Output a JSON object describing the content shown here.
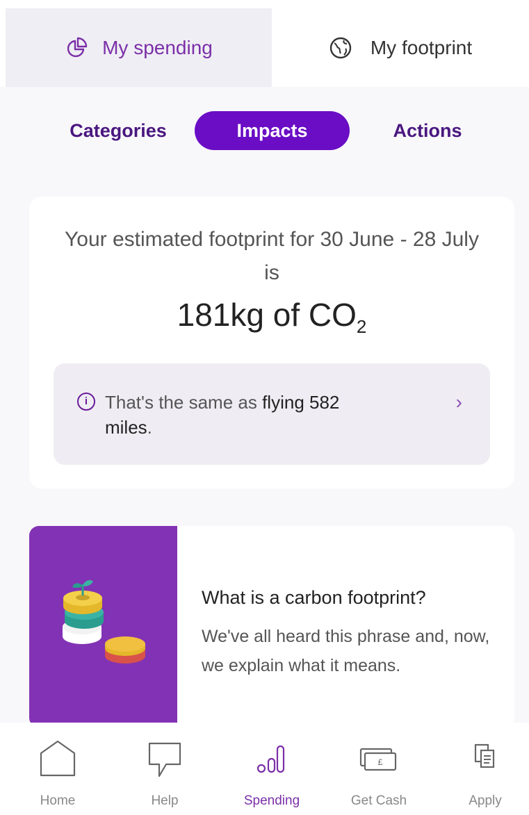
{
  "top_tabs": {
    "spending": {
      "label": "My spending",
      "icon": "pie-chart-icon"
    },
    "footprint": {
      "label": "My footprint",
      "icon": "globe-icon"
    }
  },
  "segments": {
    "categories": "Categories",
    "impacts": "Impacts",
    "actions": "Actions"
  },
  "footprint_card": {
    "estimate_text": "Your estimated footprint for 30 June - 28 July is",
    "co2_prefix": "181kg of CO",
    "co2_sub": "2",
    "info_prefix": "That's the same as ",
    "info_bold": "flying 582",
    "info_suffix": "miles",
    "info_period": ".",
    "info_icon": "info-icon",
    "chevron_icon": "chevron-right-icon"
  },
  "article_card": {
    "title": "What is a carbon footprint?",
    "subtitle": "We've all heard this phrase and, now, we explain what it means.",
    "image": "coins-plant-illustration"
  },
  "bottom_nav": {
    "home": {
      "label": "Home",
      "icon": "home-icon"
    },
    "help": {
      "label": "Help",
      "icon": "chat-bubble-icon"
    },
    "spending": {
      "label": "Spending",
      "icon": "spending-bars-icon",
      "active": true
    },
    "get_cash": {
      "label": "Get Cash",
      "icon": "cash-note-icon"
    },
    "apply": {
      "label": "Apply",
      "icon": "apply-documents-icon"
    }
  },
  "colors": {
    "brand_purple": "#6a0dc5",
    "dark_purple": "#4a1780",
    "card_image_bg": "#8232b4"
  }
}
